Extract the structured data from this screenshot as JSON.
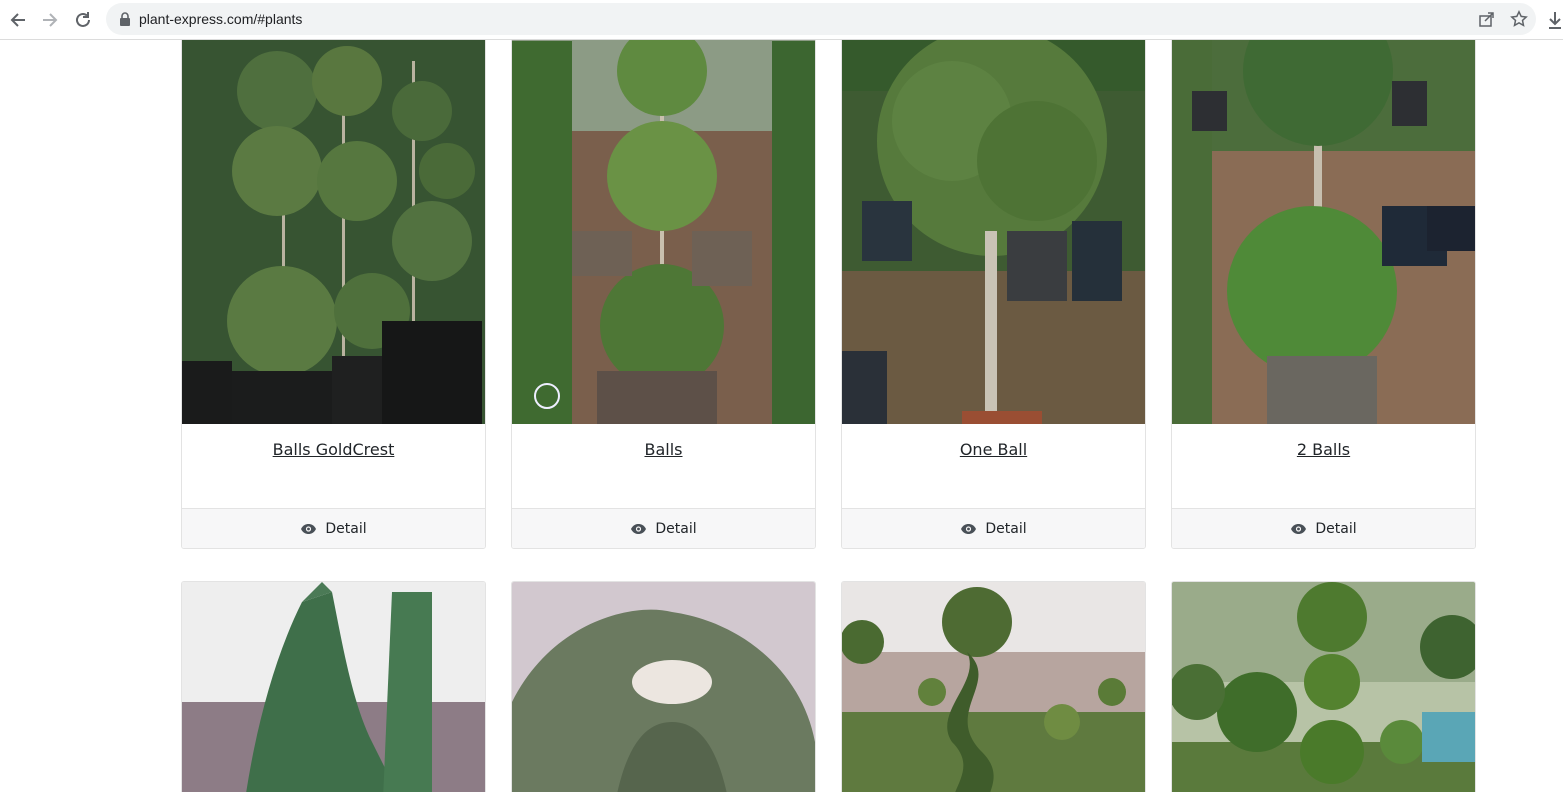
{
  "browser": {
    "url": "plant-express.com/#plants"
  },
  "products": [
    {
      "title": "Balls GoldCrest",
      "detail_label": "Detail"
    },
    {
      "title": "Balls",
      "detail_label": "Detail"
    },
    {
      "title": "One Ball",
      "detail_label": "Detail"
    },
    {
      "title": "2 Balls",
      "detail_label": "Detail"
    }
  ],
  "icons": {
    "back": "arrow-left-icon",
    "forward": "arrow-right-icon",
    "reload": "reload-icon",
    "lock": "lock-icon",
    "share": "share-icon",
    "bookmark": "star-icon",
    "download": "download-icon",
    "detail": "eye-icon"
  },
  "colors": {
    "text": "#212529",
    "footer_bg": "#f7f7f8",
    "border": "#e3e3e3",
    "address_bg": "#f1f3f4"
  }
}
